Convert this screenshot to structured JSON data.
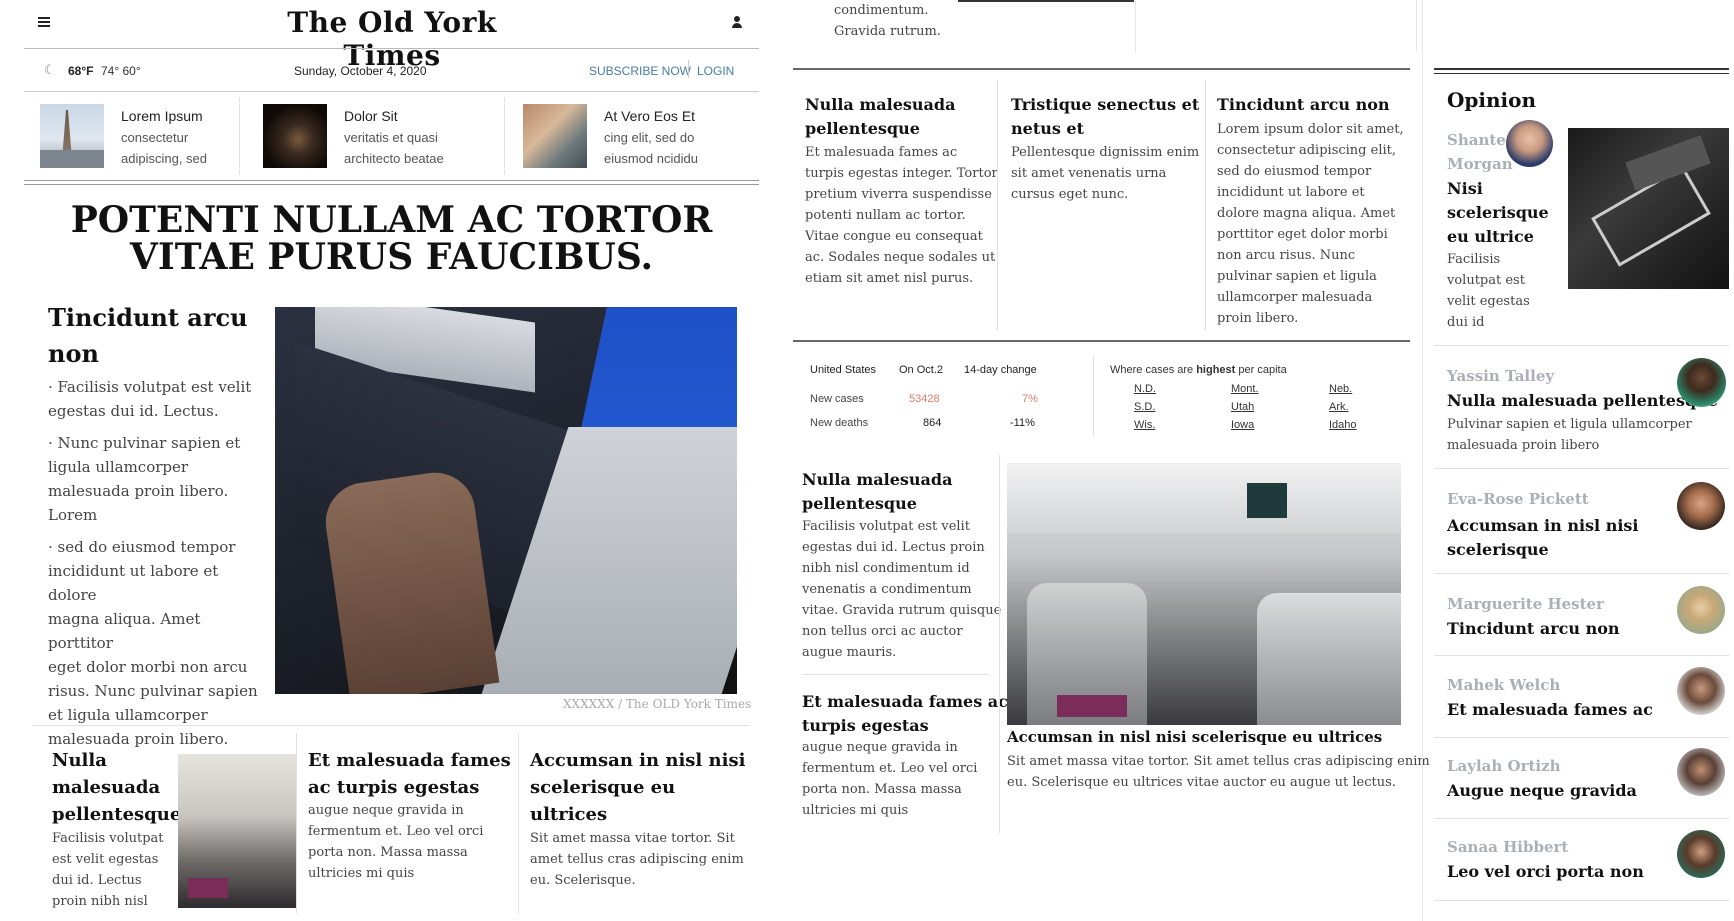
{
  "masthead": {
    "logo": "The Old York Times",
    "weather_temp": "68°F",
    "weather_range": "74° 60°",
    "date": "Sunday, October 4, 2020",
    "subscribe": "SUBSCRIBE NOW",
    "login": "LOGIN"
  },
  "top_stories": [
    {
      "title": "Lorem Ipsum",
      "line1": "consectetur",
      "line2": "adipiscing, sed"
    },
    {
      "title": "Dolor Sit",
      "line1": "veritatis et quasi",
      "line2": "architecto beatae"
    },
    {
      "title": "At Vero Eos Et",
      "line1": "cing elit, sed do",
      "line2": "eiusmod ncididu"
    }
  ],
  "lead": {
    "headline_line1": "POTENTI NULLAM AC TORTOR",
    "headline_line2": "VITAE PURUS FAUCIBUS.",
    "title_line1": "Tincidunt arcu",
    "title_line2": "non",
    "p1_l1": "· Facilisis volutpat est velit",
    "p1_l2": "egestas dui id. Lectus.",
    "p2_l1": "· Nunc pulvinar sapien et",
    "p2_l2": "ligula ullamcorper",
    "p2_l3": "malesuada proin libero.",
    "p2_l4": "Lorem",
    "p3_l1": "· sed do eiusmod tempor",
    "p3_l2": "incididunt ut labore et dolore",
    "p3_l3": "magna aliqua. Amet porttitor",
    "p3_l4": "eget dolor morbi non arcu",
    "p3_l5": "risus. Nunc pulvinar sapien",
    "p3_l6": "et ligula ullamcorper",
    "p3_l7": "malesuada proin libero.",
    "caption": "XXXXXX / The OLD York Times"
  },
  "bottom_row": [
    {
      "t1": "Nulla",
      "t2": "malesuada",
      "t3": "pellentesque",
      "b1": "Facilisis volutpat",
      "b2": "est velit egestas",
      "b3": "dui id. Lectus",
      "b4": "proin nibh nisl"
    },
    {
      "t1": "Et malesuada fames",
      "t2": "ac turpis egestas",
      "b1": "augue neque gravida in",
      "b2": "fermentum et. Leo vel orci",
      "b3": "porta non. Massa massa",
      "b4": "ultricies mi quis"
    },
    {
      "t1": "Accumsan in nisl nisi",
      "t2": "scelerisque eu",
      "t3": "ultrices",
      "b1": "Sit amet massa vitae tortor. Sit",
      "b2": "amet tellus cras adipiscing enim",
      "b3": "eu. Scelerisque."
    }
  ],
  "mid_top_fragment": {
    "l1": "condimentum.",
    "l2": "Gravida rutrum."
  },
  "mid_columns": [
    {
      "t1": "Nulla malesuada",
      "t2": "pellentesque",
      "lines": [
        "Et malesuada fames ac",
        "turpis egestas integer. Tortor",
        "pretium viverra suspendisse",
        "potenti nullam ac tortor.",
        "Vitae congue eu consequat",
        "ac. Sodales neque sodales ut",
        "etiam sit amet nisl purus."
      ]
    },
    {
      "t1": "Tristique senectus et",
      "t2": "netus et",
      "lines": [
        "Pellentesque dignissim enim",
        "sit amet venenatis urna",
        "cursus eget nunc."
      ]
    },
    {
      "t1": "Tincidunt arcu non",
      "t2": "",
      "lines": [
        "Lorem ipsum dolor sit amet,",
        "consectetur adipiscing elit,",
        "sed do eiusmod tempor",
        "incididunt ut labore et",
        "dolore magna aliqua. Amet",
        "porttitor eget dolor morbi",
        "non arcu risus. Nunc",
        "pulvinar sapien et ligula",
        "ullamcorper malesuada",
        "proin libero."
      ]
    }
  ],
  "covid": {
    "h_country": "United States",
    "h_date": "On Oct.2",
    "h_change": "14-day change",
    "r1_label": "New cases",
    "r1_value": "53428",
    "r1_change": "7%",
    "r2_label": "New deaths",
    "r2_value": "864",
    "r2_change": "-11%",
    "where_pre": "Where cases are ",
    "where_bold": "highest",
    "where_post": " per capita",
    "states": [
      "N.D.",
      "Mont.",
      "Neb.",
      "S.D.",
      "Utah",
      "Ark.",
      "Wis.",
      "Iowa",
      "Idaho"
    ],
    "color_red": "#e07a6a"
  },
  "mid_lower": {
    "a1_t1": "Nulla malesuada",
    "a1_t2": "pellentesque",
    "a1_lines": [
      "Facilisis volutpat est velit",
      "egestas dui id. Lectus proin",
      "nibh nisl condimentum id",
      "venenatis a condimentum",
      "vitae. Gravida rutrum quisque",
      "non tellus orci ac auctor",
      "augue mauris."
    ],
    "a2_t1": "Et malesuada fames ac",
    "a2_t2": "turpis egestas",
    "a2_lines": [
      "augue neque gravida in",
      "fermentum et. Leo vel orci",
      "porta non. Massa massa",
      "ultricies mi quis"
    ],
    "feature_title": "Accumsan in nisl nisi scelerisque eu ultrices",
    "feature_l1": "Sit amet massa vitae tortor. Sit amet tellus cras adipiscing enim",
    "feature_l2": "eu. Scelerisque eu ultrices vitae auctor eu augue ut lectus."
  },
  "opinion": {
    "heading": "Opinion",
    "lead_author1": "Shante",
    "lead_author2": "Morgan",
    "lead_t1": "Nisi",
    "lead_t2": "scelerisque",
    "lead_t3": "eu ultrice",
    "lead_b1": "Facilisis",
    "lead_b2": "volutpat est",
    "lead_b3": "velit egestas",
    "lead_b4": "dui id",
    "items": [
      {
        "author": "Yassin Talley",
        "title": "Nulla malesuada pellentesque",
        "l1": "Pulvinar sapien et ligula ullamcorper",
        "l2": "malesuada proin libero"
      },
      {
        "author": "Eva-Rose Pickett",
        "title": "Accumsan in nisl nisi",
        "title2": "scelerisque"
      },
      {
        "author": "Marguerite Hester",
        "title": "Tincidunt arcu non"
      },
      {
        "author": "Mahek Welch",
        "title": "Et malesuada fames ac"
      },
      {
        "author": "Laylah Ortizh",
        "title": "Augue neque gravida"
      },
      {
        "author": "Sanaa Hibbert",
        "title": "Leo vel orci porta non"
      }
    ]
  }
}
